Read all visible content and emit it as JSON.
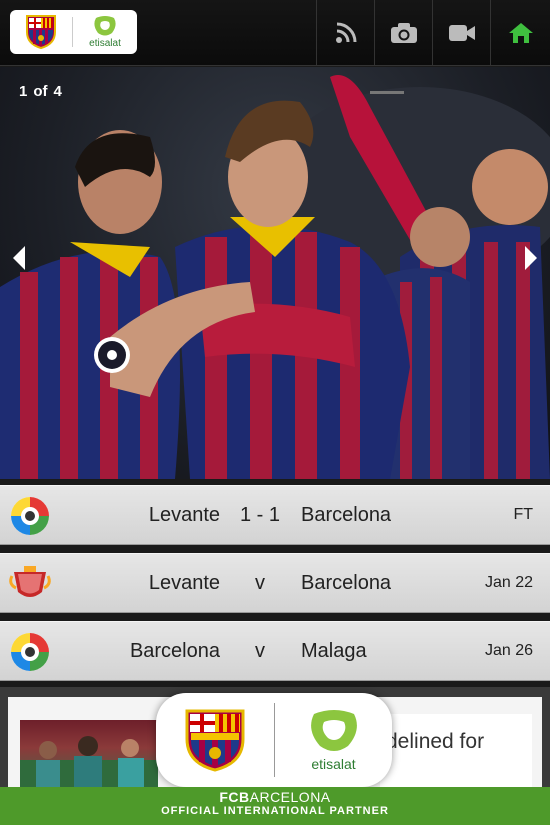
{
  "header": {
    "partner_name": "etisalat",
    "tools": [
      {
        "icon": "rss-icon"
      },
      {
        "icon": "camera-icon"
      },
      {
        "icon": "video-icon"
      },
      {
        "icon": "home-icon"
      }
    ],
    "active_color": "#3fbf3f"
  },
  "slideshow": {
    "current": "1",
    "of_label": "of",
    "total": "4"
  },
  "fixtures": [
    {
      "competition_icon": "liga-bbva-logo",
      "home": "Levante",
      "score": "1 - 1",
      "away": "Barcelona",
      "status": "FT"
    },
    {
      "competition_icon": "copa-del-rey-logo",
      "home": "Levante",
      "score": "v",
      "away": "Barcelona",
      "status": "Jan 22"
    },
    {
      "competition_icon": "liga-bbva-logo",
      "home": "Barcelona",
      "score": "v",
      "away": "Malaga",
      "status": "Jan 26"
    }
  ],
  "news": {
    "snippet": "delined for"
  },
  "partner_banner": {
    "partner_name": "etisalat",
    "club_prefix": "FCB",
    "club_suffix": "ARCELONA",
    "tagline": "OFFICIAL INTERNATIONAL PARTNER",
    "color": "#4e9a2a"
  }
}
